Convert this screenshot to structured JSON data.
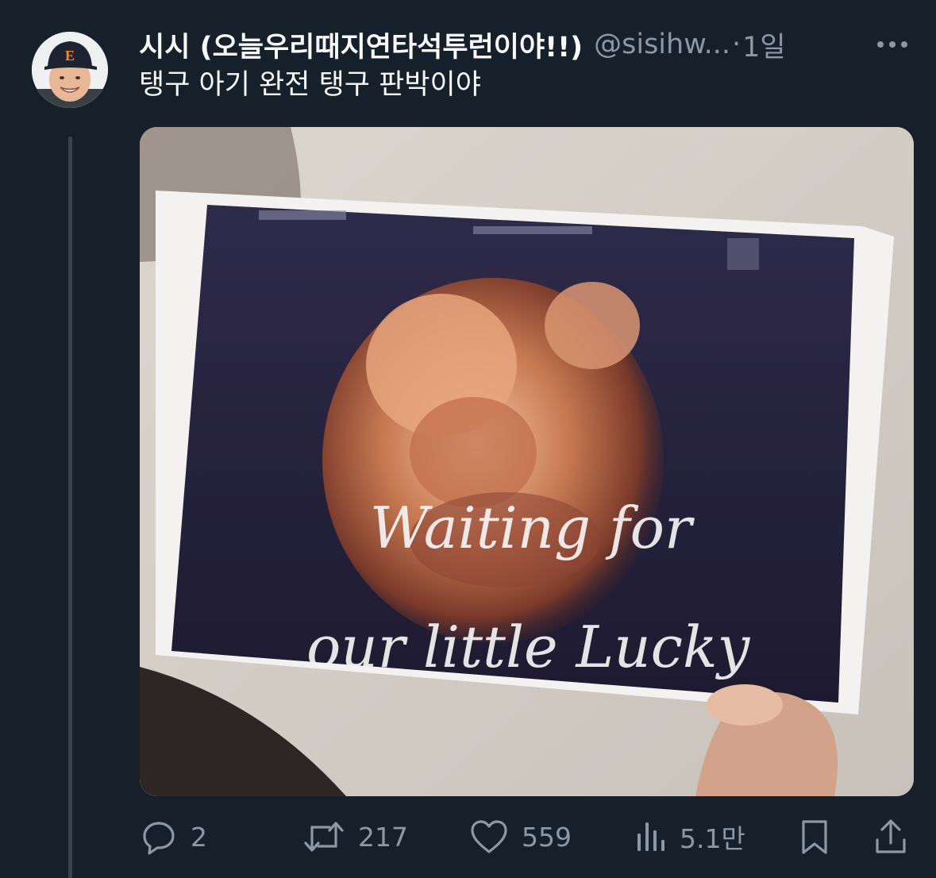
{
  "tweet": {
    "display_name": "시시 (오늘우리때지연타석투런이야!!)",
    "handle": "@sisihw...",
    "separator": "·",
    "time": "1일",
    "more_icon": "more-icon",
    "text": "탱구 아기 완전 탱구 판박이야"
  },
  "media": {
    "overlay_line1": "Waiting for",
    "overlay_line2": "our little Lucky"
  },
  "actions": {
    "reply_count": "2",
    "retweet_count": "217",
    "like_count": "559",
    "views_count": "5.1만"
  },
  "colors": {
    "background": "#15202b",
    "text_primary": "#f7f9f9",
    "text_secondary": "#8b98a5",
    "thread_line": "#38444d"
  }
}
